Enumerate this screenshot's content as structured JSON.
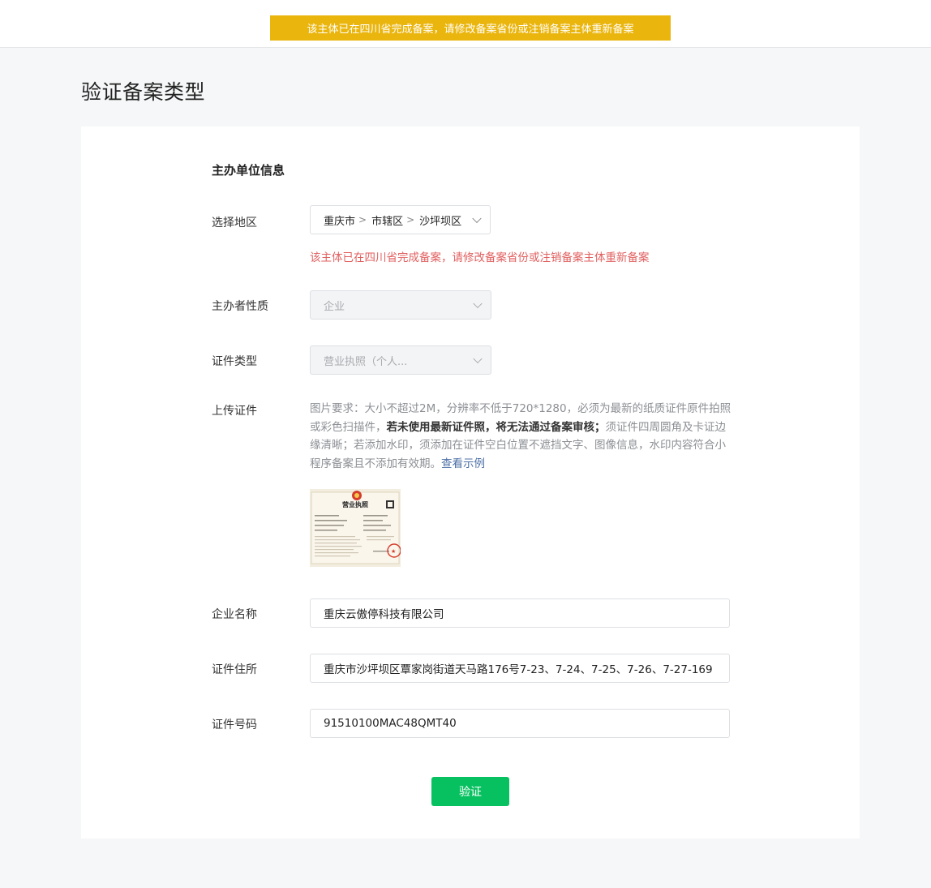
{
  "top_alert": "该主体已在四川省完成备案，请修改备案省份或注销备案主体重新备案",
  "page_title": "验证备案类型",
  "section_title": "主办单位信息",
  "region": {
    "label": "选择地区",
    "parts": [
      "重庆市",
      "市辖区",
      "沙坪坝区"
    ],
    "error": "该主体已在四川省完成备案，请修改备案省份或注销备案主体重新备案"
  },
  "organizer_nature": {
    "label": "主办者性质",
    "value": "企业"
  },
  "cert_type": {
    "label": "证件类型",
    "value": "营业执照（个人..."
  },
  "upload": {
    "label": "上传证件",
    "desc_part1": "图片要求：大小不超过2M，分辨率不低于720*1280，必须为最新的纸质证件原件拍照或彩色扫描件，",
    "desc_bold": "若未使用最新证件照，将无法通过备案审核；",
    "desc_part2": "须证件四周圆角及卡证边缘清晰；若添加水印，须添加在证件空白位置不遮挡文字、图像信息，水印内容符合小程序备案且不添加有效期。",
    "example_link": "查看示例",
    "thumb_title": "营业执照"
  },
  "company_name": {
    "label": "企业名称",
    "value": "重庆云傲停科技有限公司"
  },
  "cert_address": {
    "label": "证件住所",
    "value": "重庆市沙坪坝区覃家岗街道天马路176号7-23、7-24、7-25、7-26、7-27-169"
  },
  "cert_number": {
    "label": "证件号码",
    "value": "91510100MAC48QMT40"
  },
  "verify_button": "验证",
  "colors": {
    "alert_bg": "#eab50c",
    "error_text": "#e15f5f",
    "primary_button": "#07c160",
    "link": "#4b6fa6"
  }
}
